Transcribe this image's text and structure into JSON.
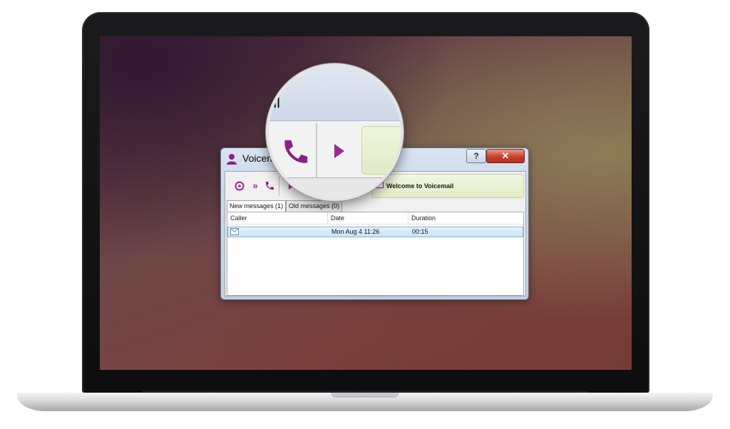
{
  "window": {
    "title": "Voicemail",
    "help_button": "?",
    "close_button": "✕"
  },
  "toolbar": {
    "icons": [
      "stop-icon",
      "forward-icon",
      "phone-icon",
      "play-icon"
    ],
    "welcome_text": "Welcome to Voicemail"
  },
  "tabs": [
    {
      "label": "New messages (1)",
      "active": true
    },
    {
      "label": "Old messages (0)",
      "active": false
    }
  ],
  "table": {
    "columns": [
      "Caller",
      "Date",
      "Duration"
    ],
    "rows": [
      {
        "caller": "",
        "date": "Mon Aug 4 11:26",
        "duration": "00:15",
        "selected": true
      }
    ]
  },
  "magnifier": {
    "title_fragment": "ail"
  },
  "colors": {
    "accent": "#9b2a8e",
    "close_red": "#c4402a",
    "selection": "#c8e5f7"
  }
}
